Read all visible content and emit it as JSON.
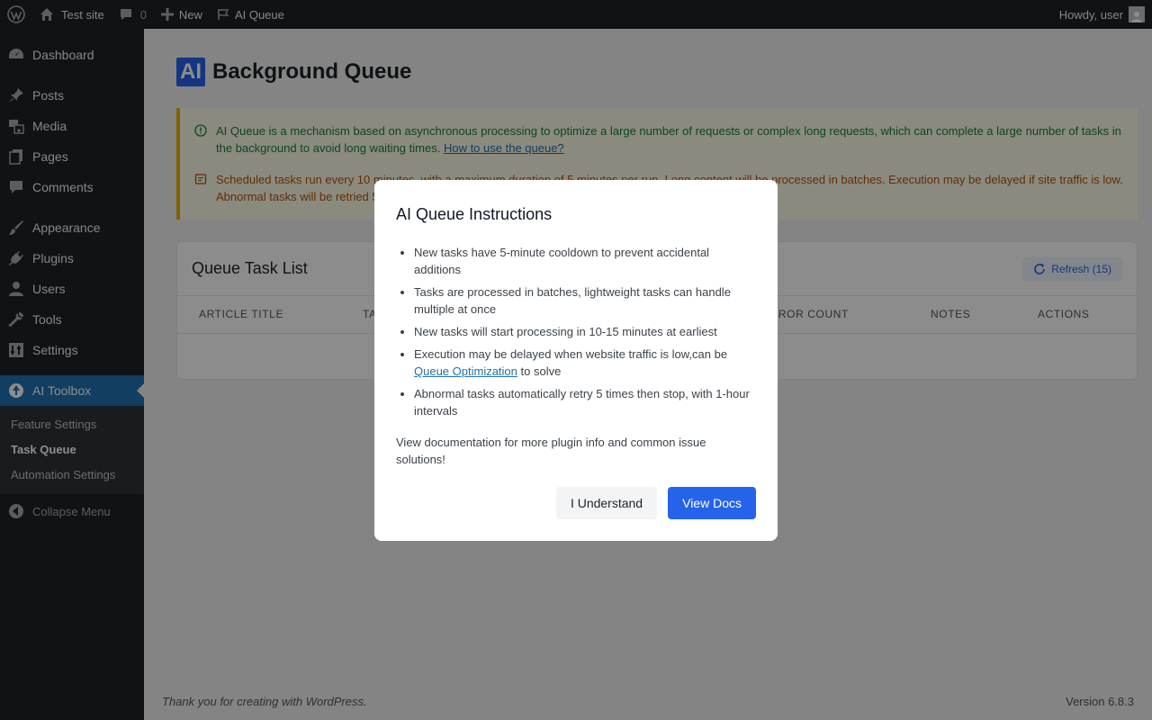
{
  "admin_bar": {
    "site_name": "Test site",
    "comments_count": "0",
    "new_label": "New",
    "ai_queue_label": "AI Queue",
    "greeting": "Howdy, user"
  },
  "sidebar": {
    "items": [
      {
        "label": "Dashboard",
        "icon": "dashboard-icon"
      },
      {
        "label": "Posts",
        "icon": "pushpin-icon"
      },
      {
        "label": "Media",
        "icon": "media-icon"
      },
      {
        "label": "Pages",
        "icon": "pages-icon"
      },
      {
        "label": "Comments",
        "icon": "comment-icon"
      },
      {
        "label": "Appearance",
        "icon": "brush-icon"
      },
      {
        "label": "Plugins",
        "icon": "plug-icon"
      },
      {
        "label": "Users",
        "icon": "user-icon"
      },
      {
        "label": "Tools",
        "icon": "wrench-icon"
      },
      {
        "label": "Settings",
        "icon": "settings-icon"
      },
      {
        "label": "AI Toolbox",
        "icon": "ai-toolbox-icon"
      }
    ],
    "submenu": [
      "Feature Settings",
      "Task Queue",
      "Automation Settings"
    ],
    "collapse_label": "Collapse Menu"
  },
  "page": {
    "badge": "AI",
    "title": "Background Queue",
    "notice_info": "AI Queue is a mechanism based on asynchronous processing to optimize a large number of requests or complex long requests, which can complete a large number of tasks in the background to avoid long waiting times.",
    "notice_info_link": "How to use the queue?",
    "notice_schedule": "Scheduled tasks run every 10 minutes, with a maximum duration of 5 minutes per run. Long content will be processed in batches. Execution may be delayed if site traffic is low. Abnormal tasks will be retried 5 times.",
    "card_title": "Queue Task List",
    "refresh_label": "Refresh (15)",
    "columns": [
      "Article Title",
      "Ta",
      "Error Count",
      "Notes",
      "Actions"
    ]
  },
  "footer": {
    "thanks": "Thank you for creating with WordPress.",
    "version": "Version 6.8.3"
  },
  "modal": {
    "title": "AI Queue Instructions",
    "items": [
      "New tasks have 5-minute cooldown to prevent accidental additions",
      "Tasks are processed in batches, lightweight tasks can handle multiple at once",
      "New tasks will start processing in 10-15 minutes at earliest",
      "Abnormal tasks automatically retry 5 times then stop, with 1-hour intervals"
    ],
    "item4_prefix": "Execution may be delayed when website traffic is low,can be ",
    "item4_link": "Queue Optimization",
    "item4_suffix": " to solve",
    "doc_text": "View documentation for more plugin info and common issue solutions!",
    "btn_understand": "I Understand",
    "btn_docs": "View Docs"
  },
  "colors": {
    "accent": "#2563eb",
    "wp_blue": "#2271b1",
    "admin_dark": "#1d2327",
    "notice_green": "#15803d",
    "notice_orange": "#b45309"
  }
}
